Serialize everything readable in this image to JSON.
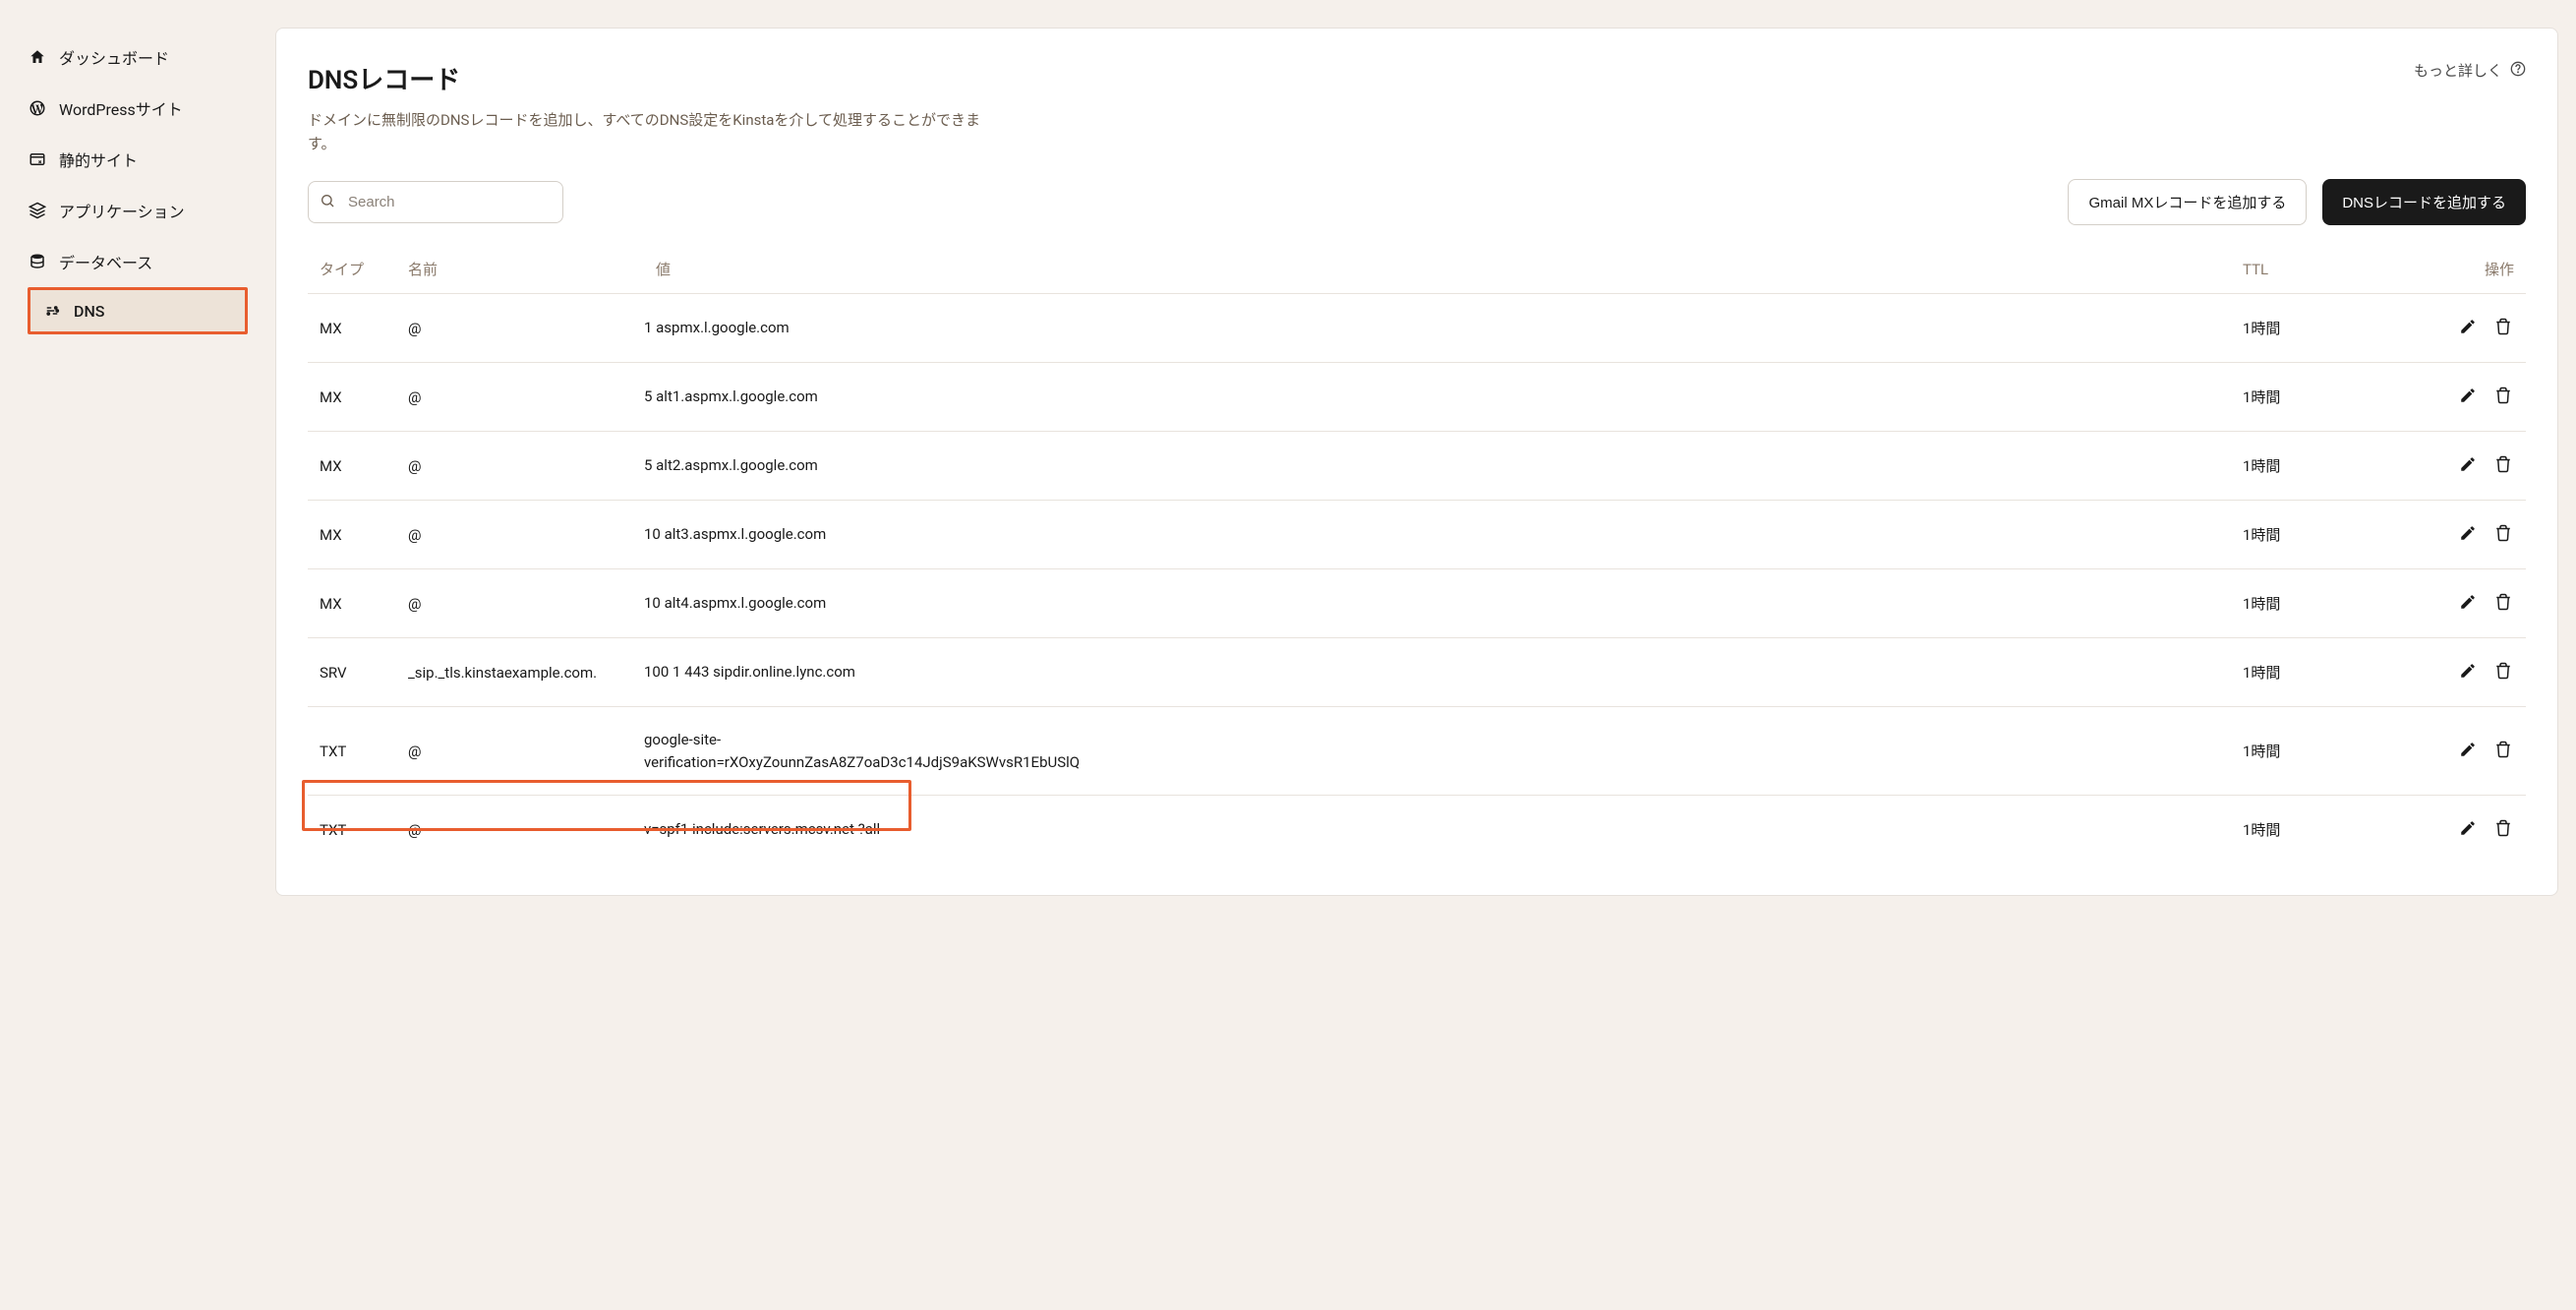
{
  "sidebar": {
    "items": [
      {
        "label": "ダッシュボード",
        "icon": "home"
      },
      {
        "label": "WordPressサイト",
        "icon": "wordpress"
      },
      {
        "label": "静的サイト",
        "icon": "browser"
      },
      {
        "label": "アプリケーション",
        "icon": "stack"
      },
      {
        "label": "データベース",
        "icon": "database"
      },
      {
        "label": "DNS",
        "icon": "dns",
        "active": true
      }
    ]
  },
  "page": {
    "title": "DNSレコード",
    "description": "ドメインに無制限のDNSレコードを追加し、すべてのDNS設定をKinstaを介して処理することができます。",
    "help_link": "もっと詳しく"
  },
  "toolbar": {
    "search_placeholder": "Search",
    "gmail_button": "Gmail MXレコードを追加する",
    "add_button": "DNSレコードを追加する"
  },
  "table": {
    "headers": {
      "type": "タイプ",
      "name": "名前",
      "value": "値",
      "ttl": "TTL",
      "actions": "操作"
    },
    "rows": [
      {
        "type": "MX",
        "name": "@",
        "value": "1 aspmx.l.google.com",
        "ttl": "1時間"
      },
      {
        "type": "MX",
        "name": "@",
        "value": "5 alt1.aspmx.l.google.com",
        "ttl": "1時間"
      },
      {
        "type": "MX",
        "name": "@",
        "value": "5 alt2.aspmx.l.google.com",
        "ttl": "1時間"
      },
      {
        "type": "MX",
        "name": "@",
        "value": "10 alt3.aspmx.l.google.com",
        "ttl": "1時間"
      },
      {
        "type": "MX",
        "name": "@",
        "value": "10 alt4.aspmx.l.google.com",
        "ttl": "1時間"
      },
      {
        "type": "SRV",
        "name": "_sip._tls.kinstaexample.com.",
        "value": "100 1 443 sipdir.online.lync.com",
        "ttl": "1時間"
      },
      {
        "type": "TXT",
        "name": "@",
        "value": "google-site-verification=rXOxyZounnZasA8Z7oaD3c14JdjS9aKSWvsR1EbUSlQ",
        "ttl": "1時間"
      },
      {
        "type": "TXT",
        "name": "@",
        "value": "v=spf1 include:servers.mcsv.net ?all",
        "ttl": "1時間",
        "highlighted": true
      }
    ]
  }
}
